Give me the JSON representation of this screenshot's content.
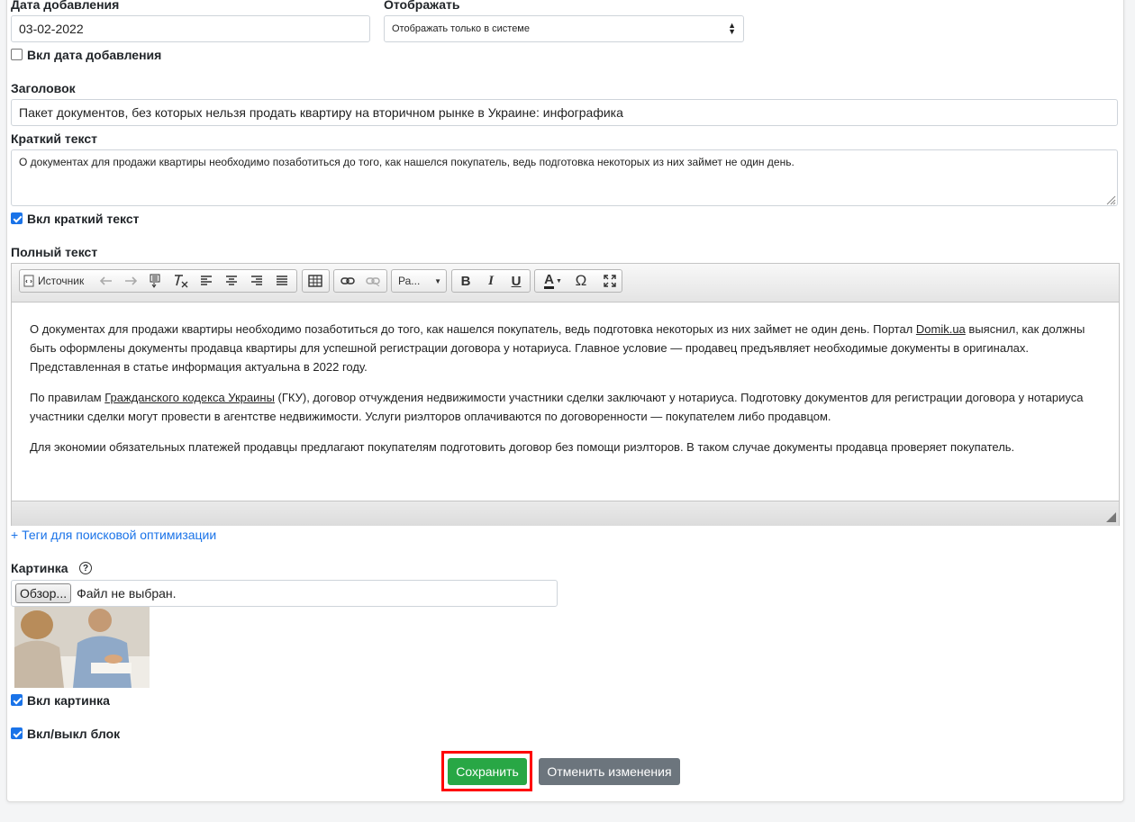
{
  "fields": {
    "date_label": "Дата добавления",
    "date_value": "03-02-2022",
    "display_label": "Отображать",
    "display_value": "Отображать только в системе",
    "date_enable_label": "Вкл дата добавления",
    "title_label": "Заголовок",
    "title_value": "Пакет документов, без которых нельзя продать квартиру на вторичном рынке в Украине: инфографика",
    "short_label": "Краткий текст",
    "short_value": "О документах для продажи квартиры необходимо позаботиться до того, как нашелся покупатель, ведь подготовка некоторых из них займет не один день.",
    "short_enable_label": "Вкл краткий текст",
    "full_label": "Полный текст"
  },
  "toolbar": {
    "source_label": "Источник",
    "format_label": "Ра...",
    "bold": "B",
    "italic": "I",
    "underline": "U",
    "text_color": "A",
    "special_char": "Ω"
  },
  "editor": {
    "p1_a": "О документах для продажи квартиры необходимо позаботиться до того, как нашелся покупатель, ведь подготовка некоторых из них займет не один день. Портал ",
    "p1_link": "Domik.ua",
    "p1_b": " выяснил, как должны быть оформлены документы продавца квартиры для успешной регистрации договора у нотариуса. Главное условие — продавец предъявляет необходимые документы в оригиналах. Представленная в статье информация актуальна в 2022 году.",
    "p2_a": "По правилам ",
    "p2_link": "Гражданского кодекса Украины",
    "p2_b": " (ГКУ), договор отчуждения недвижимости участники сделки заключают у нотариуса. Подготовку документов для регистрации договора у нотариуса участники сделки могут провести в агентстве недвижимости. Услуги риэлторов оплачиваются по договоренности — покупателем либо продавцом.",
    "p3": "Для экономии обязательных платежей продавцы предлагают покупателям подготовить договор без помощи риэлторов. В таком случае документы продавца проверяет покупатель."
  },
  "seo_link": "+ Теги для поисковой оптимизации",
  "image": {
    "label": "Картинка",
    "help": "?",
    "browse_label": "Обзор...",
    "file_status": "Файл не выбран.",
    "enable_label": "Вкл картинка"
  },
  "block_enable_label": "Вкл/выкл блок",
  "actions": {
    "save": "Сохранить",
    "cancel": "Отменить изменения"
  },
  "colors": {
    "link": "#1a73e8",
    "save_bg": "#28a745",
    "cancel_bg": "#6c757d",
    "highlight": "#ff0000"
  }
}
